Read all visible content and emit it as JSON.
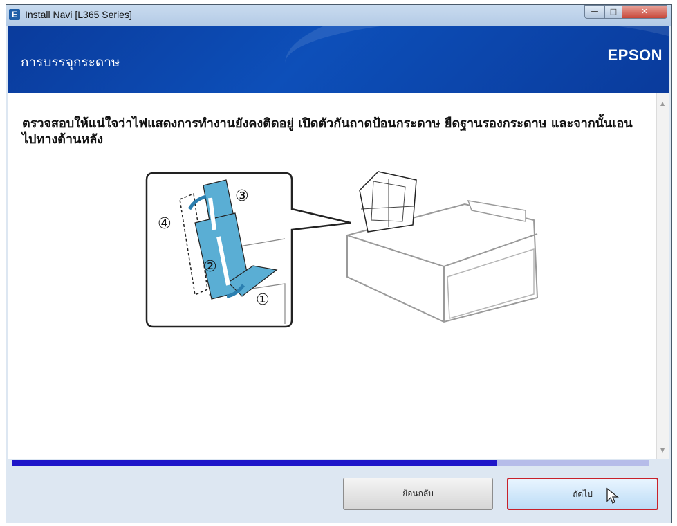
{
  "window": {
    "title": "Install Navi [L365 Series]",
    "app_icon_letter": "E"
  },
  "header": {
    "page_title": "การบรรจุกระดาษ",
    "logo": "EPSON"
  },
  "content": {
    "instruction": "ตรวจสอบให้แน่ใจว่าไฟแสดงการทำงานยังคงติดอยู่ เปิดตัวกันถาดป้อนกระดาษ ยืดฐานรองกระดาษ และจากนั้นเอนไปทางด้านหลัง",
    "steps": [
      "①",
      "②",
      "③",
      "④"
    ]
  },
  "progress": {
    "fraction": 0.76
  },
  "buttons": {
    "back_label": "ย้อนกลับ",
    "next_label": "ถัดไป"
  },
  "colors": {
    "header_blue": "#0a3b9c",
    "progress_fill": "#1f16c9",
    "highlight": "#c8212a",
    "illustration_accent": "#5aaed4"
  }
}
